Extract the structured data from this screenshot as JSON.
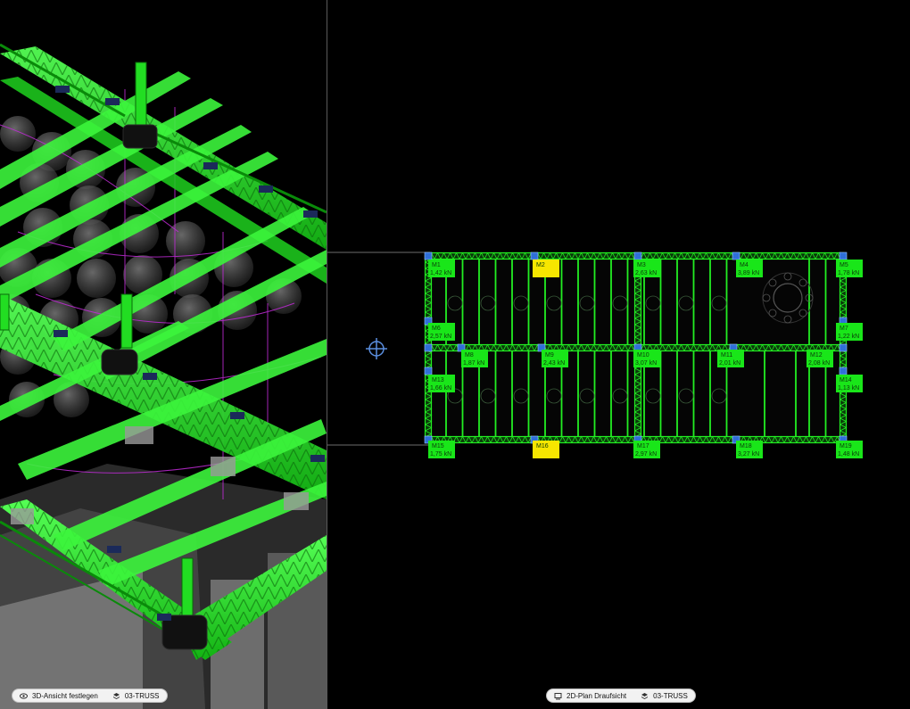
{
  "viewport_3d": {
    "view_label": "3D-Ansicht festlegen",
    "view_icon": "3d-view-icon",
    "layer_label": "03-TRUSS",
    "layer_icon": "layers-icon"
  },
  "viewport_2d": {
    "view_label": "2D-Plan Draufsicht",
    "view_icon": "2d-plan-icon",
    "layer_label": "03-TRUSS",
    "layer_icon": "layers-icon",
    "motors": [
      {
        "id": "M1",
        "load": "1,42 kN",
        "highlight": false
      },
      {
        "id": "M2",
        "load": "",
        "highlight": true
      },
      {
        "id": "M3",
        "load": "2,63 kN",
        "highlight": false
      },
      {
        "id": "M4",
        "load": "3,89 kN",
        "highlight": false
      },
      {
        "id": "M5",
        "load": "1,78 kN",
        "highlight": false
      },
      {
        "id": "M6",
        "load": "2,57 kN",
        "highlight": false
      },
      {
        "id": "M7",
        "load": "1,22 kN",
        "highlight": false
      },
      {
        "id": "M8",
        "load": "1,87 kN",
        "highlight": false
      },
      {
        "id": "M9",
        "load": "2,43 kN",
        "highlight": false
      },
      {
        "id": "M10",
        "load": "3,07 kN",
        "highlight": false
      },
      {
        "id": "M11",
        "load": "2,01 kN",
        "highlight": false
      },
      {
        "id": "M12",
        "load": "2,08 kN",
        "highlight": false
      },
      {
        "id": "M13",
        "load": "1,66 kN",
        "highlight": false
      },
      {
        "id": "M14",
        "load": "1,13 kN",
        "highlight": false
      },
      {
        "id": "M15",
        "load": "1,75 kN",
        "highlight": false
      },
      {
        "id": "M16",
        "load": "",
        "highlight": true
      },
      {
        "id": "M17",
        "load": "2,97 kN",
        "highlight": false
      },
      {
        "id": "M18",
        "load": "3,27 kN",
        "highlight": false
      },
      {
        "id": "M19",
        "load": "1,48 kN",
        "highlight": false
      }
    ]
  },
  "colors": {
    "truss_green": "#22ee22",
    "truss_dark": "#0a8a0a",
    "label_green": "#19e619",
    "label_yellow": "#f7e600",
    "handle_blue": "#2f6fd8",
    "cursor_blue": "#5b8fe0"
  }
}
